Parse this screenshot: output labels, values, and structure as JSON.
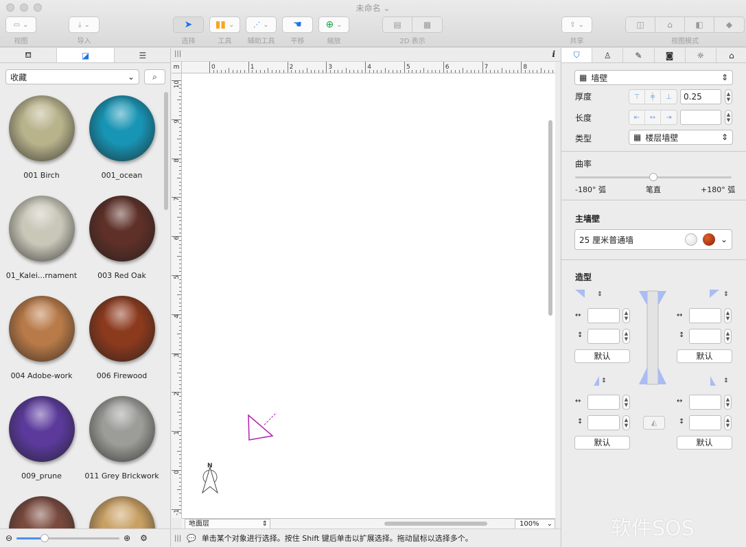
{
  "window": {
    "title": "未命名 ⌄"
  },
  "toolbar": {
    "view_label": "视图",
    "import_label": "导入",
    "select_label": "选择",
    "tools_label": "工具",
    "aux_label": "辅助工具",
    "pan_label": "平移",
    "zoom_label": "缩放",
    "display_label": "2D 表示",
    "share_label": "共享",
    "viewmode_label": "视图模式"
  },
  "library": {
    "dropdown": "收藏",
    "materials": [
      {
        "name": "001 Birch",
        "color": "#b9b38c"
      },
      {
        "name": "001_ocean",
        "color": "#1894b4"
      },
      {
        "name": "01_Kalei...rnament",
        "color": "#c9c7b8"
      },
      {
        "name": "003 Red Oak",
        "color": "#5e3028"
      },
      {
        "name": "004 Adobe-work",
        "color": "#b87a48"
      },
      {
        "name": "006 Firewood",
        "color": "#8c3a1e"
      },
      {
        "name": "009_prune",
        "color": "#5b3a9c"
      },
      {
        "name": "011 Grey Brickwork",
        "color": "#9c9c98"
      },
      {
        "name": "",
        "color": "#7a4a3e"
      },
      {
        "name": "",
        "color": "#c9a064"
      }
    ]
  },
  "canvas": {
    "ruler_unit": "m",
    "h_ticks": [
      "0",
      "1",
      "2",
      "3",
      "4",
      "5",
      "6",
      "7",
      "8"
    ],
    "v_ticks": [
      "10",
      "9",
      "8",
      "7",
      "6",
      "5",
      "4",
      "3",
      "2",
      "1",
      "0",
      "-1"
    ],
    "layer": "地面层",
    "zoom": "100%",
    "compass_letter": "N",
    "status": "单击某个对象进行选择。按住 Shift 键后单击以扩展选择。拖动鼠标以选择多个。"
  },
  "inspector": {
    "object_type": "墙壁",
    "thickness_label": "厚度",
    "thickness_value": "0.25",
    "length_label": "长度",
    "length_value": "",
    "type_label": "类型",
    "type_value": "楼层墙壁",
    "curvature_label": "曲率",
    "curve_min": "-180° 弧",
    "curve_mid": "笔直",
    "curve_max": "+180° 弧",
    "curvature_fraction": 0.5,
    "main_wall_label": "主墙壁",
    "main_wall_value": "25 厘米普通墙",
    "shape_label": "造型",
    "default_label": "默认"
  },
  "watermark": "软件SOS"
}
